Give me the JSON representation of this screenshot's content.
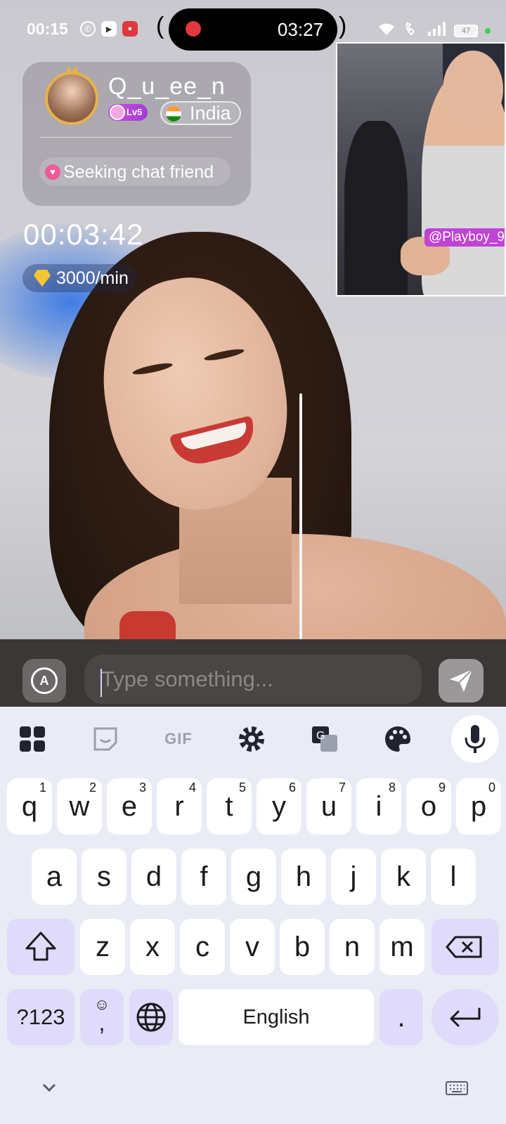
{
  "status_bar": {
    "time": "00:15",
    "recording_time": "03:27",
    "battery": "47",
    "notification_icons": [
      "whatsapp-icon",
      "youtube-icon",
      "screen-recorder-icon"
    ],
    "system_icons": [
      "wifi-icon",
      "wifi-call-icon",
      "signal-icon",
      "battery-icon"
    ]
  },
  "profile": {
    "name": "Q_u_ee_n",
    "level": "Lv5",
    "country": "India",
    "status": "Seeking chat friend"
  },
  "call": {
    "timer": "00:03:42",
    "rate": "3000/min"
  },
  "pip": {
    "handle": "@Playboy_9"
  },
  "input_bar": {
    "placeholder": "Type something..."
  },
  "keyboard": {
    "toolbar": [
      "apps-grid-icon",
      "sticker-icon",
      "gif-icon",
      "settings-icon",
      "translate-icon",
      "palette-icon",
      "mic-icon"
    ],
    "gif_label": "GIF",
    "row1": [
      {
        "k": "q",
        "s": "1"
      },
      {
        "k": "w",
        "s": "2"
      },
      {
        "k": "e",
        "s": "3"
      },
      {
        "k": "r",
        "s": "4"
      },
      {
        "k": "t",
        "s": "5"
      },
      {
        "k": "y",
        "s": "6"
      },
      {
        "k": "u",
        "s": "7"
      },
      {
        "k": "i",
        "s": "8"
      },
      {
        "k": "o",
        "s": "9"
      },
      {
        "k": "p",
        "s": "0"
      }
    ],
    "row2": [
      "a",
      "s",
      "d",
      "f",
      "g",
      "h",
      "j",
      "k",
      "l"
    ],
    "row3": [
      "z",
      "x",
      "c",
      "v",
      "b",
      "n",
      "m"
    ],
    "symbols_label": "?123",
    "comma_label": ",",
    "space_label": "English",
    "period_label": ".",
    "accent_color": "#e0dbfa"
  }
}
